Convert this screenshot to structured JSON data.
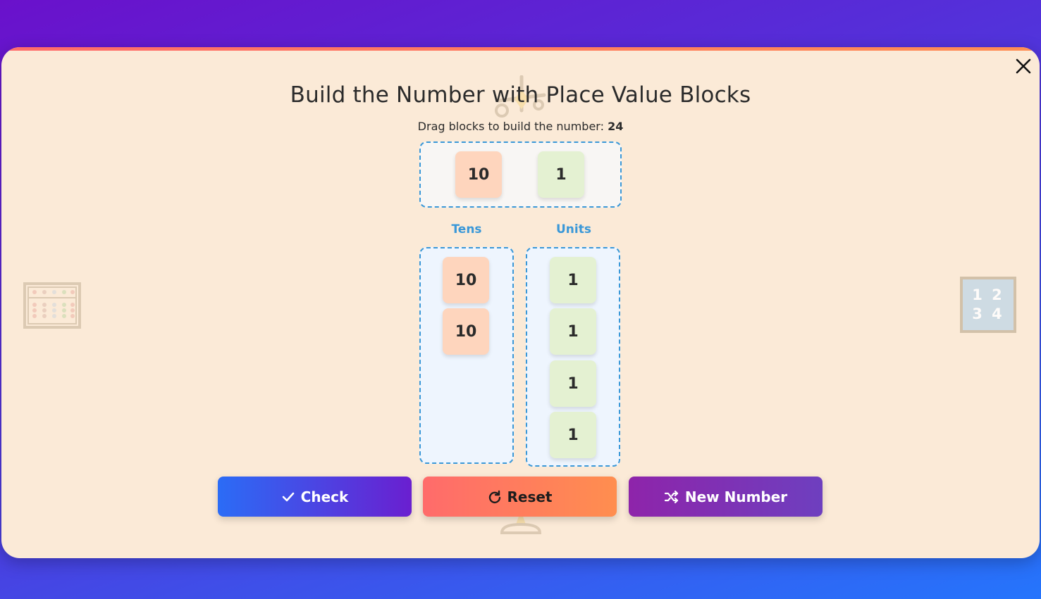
{
  "modal": {
    "title": "Build the Number with Place Value Blocks",
    "subtitle_prefix": "Drag blocks to build the number: ",
    "target_number": "24",
    "close_label": "X"
  },
  "palette": {
    "tens_block": "10",
    "unit_block": "1"
  },
  "columns": {
    "tens_label": "Tens",
    "units_label": "Units",
    "tens_blocks": [
      "10",
      "10"
    ],
    "units_blocks": [
      "1",
      "1",
      "1",
      "1"
    ]
  },
  "buttons": {
    "check": "Check",
    "reset": "Reset",
    "new_number": "New Number"
  },
  "decorations": {
    "left_icon": "abacus-icon",
    "right_icon": "number-tiles-icon",
    "right_tile_text": [
      "1 2",
      "3 4"
    ],
    "center_icon": "balance-scale-icon"
  },
  "colors": {
    "accent_blue": "#3a98d8",
    "tens_block": "#fed5bd",
    "unit_block": "#e4f1d2",
    "modal_bg": "#fbead7"
  }
}
